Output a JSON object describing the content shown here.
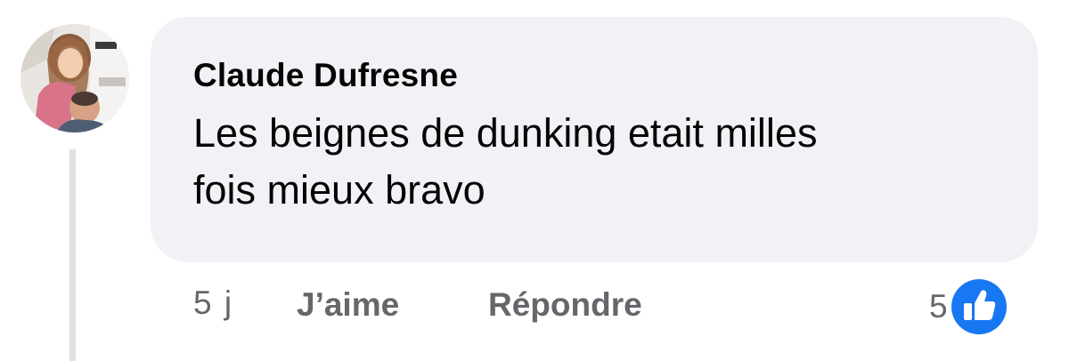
{
  "comment": {
    "author": "Claude Dufresne",
    "text": "Les beignes de dunking etait milles fois mieux bravo",
    "avatar_icon": "profile-photo-avatar"
  },
  "actions": {
    "time": "5 j",
    "like_label": "J’aime",
    "reply_label": "Répondre"
  },
  "reactions": {
    "count": "5",
    "icon": "like-thumb-icon",
    "color": "#1877f2"
  },
  "colors": {
    "bubble": "#f0f2f5",
    "text": "#050505",
    "secondary": "#65676b",
    "thread_line": "#dfe1e5"
  }
}
